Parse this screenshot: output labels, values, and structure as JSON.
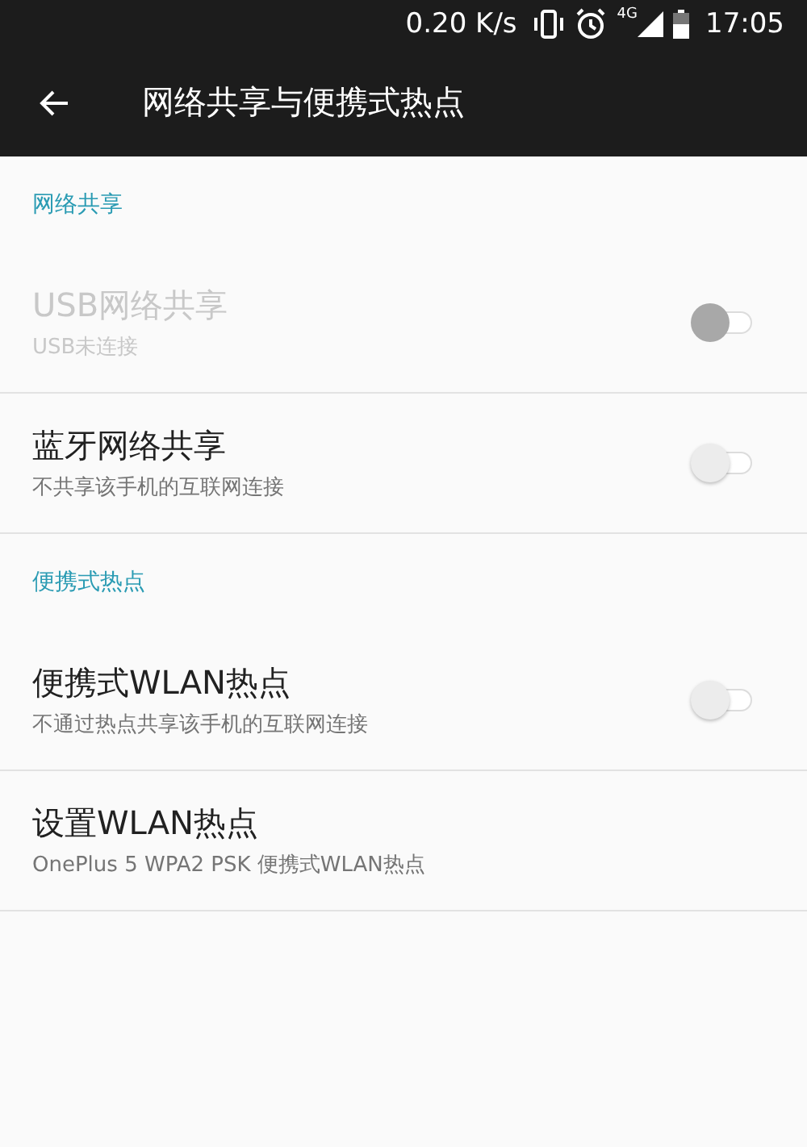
{
  "status_bar": {
    "speed": "0.20 K/s",
    "network": "4G",
    "time": "17:05"
  },
  "app_bar": {
    "title": "网络共享与便携式热点"
  },
  "sections": [
    {
      "header": "网络共享",
      "items": [
        {
          "kind": "switch",
          "title": "USB网络共享",
          "subtitle": "USB未连接",
          "on": false,
          "disabled": true
        },
        {
          "kind": "switch",
          "title": "蓝牙网络共享",
          "subtitle": "不共享该手机的互联网连接",
          "on": false,
          "disabled": false
        }
      ]
    },
    {
      "header": "便携式热点",
      "items": [
        {
          "kind": "switch",
          "title": "便携式WLAN热点",
          "subtitle": "不通过热点共享该手机的互联网连接",
          "on": false,
          "disabled": false
        },
        {
          "kind": "plain",
          "title": "设置WLAN热点",
          "subtitle": "OnePlus 5 WPA2 PSK 便携式WLAN热点",
          "disabled": false
        }
      ]
    }
  ]
}
